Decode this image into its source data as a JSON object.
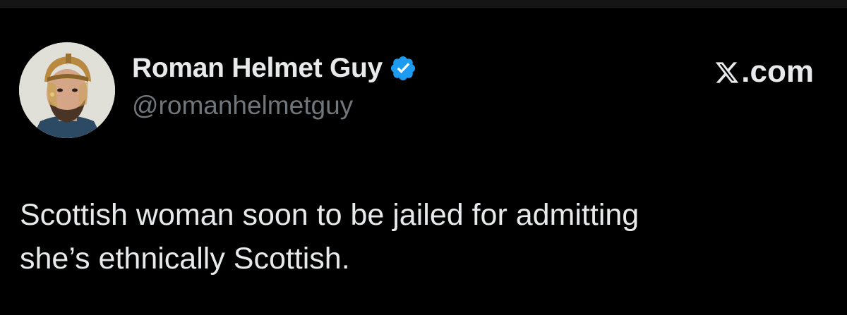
{
  "post": {
    "author": {
      "display_name": "Roman Helmet Guy",
      "handle": "@romanhelmetguy",
      "verified": true,
      "verified_color": "#1d9bf0",
      "avatar_icon": "avatar-photo"
    },
    "source": {
      "logo_icon": "x-logo-icon",
      "domain": ".com"
    },
    "text_lines": [
      "Scottish woman soon to be jailed for admitting",
      "she’s ethnically Scottish."
    ]
  },
  "colors": {
    "background": "#000000",
    "primary_text": "#e7e9ea",
    "secondary_text": "#71767b",
    "accent": "#1d9bf0"
  }
}
